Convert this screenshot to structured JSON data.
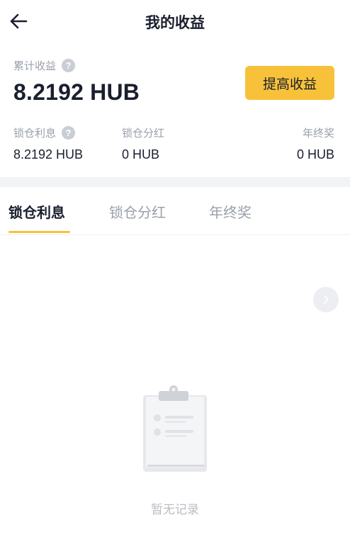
{
  "header": {
    "title": "我的收益"
  },
  "summary": {
    "total_label": "累计收益",
    "total_value": "8.2192 HUB",
    "withdraw_label": "提高收益",
    "help_glyph": "?",
    "stats": [
      {
        "label": "锁仓利息",
        "value": "8.2192 HUB"
      },
      {
        "label": "锁仓分红",
        "value": "0 HUB"
      },
      {
        "label": "年终奖",
        "value": "0 HUB"
      }
    ]
  },
  "tabs": [
    {
      "label": "锁仓利息",
      "active": true
    },
    {
      "label": "锁仓分红",
      "active": false
    },
    {
      "label": "年终奖",
      "active": false
    }
  ],
  "empty_state": {
    "text": "暂无记录",
    "icon": "clipboard-icon"
  },
  "colors": {
    "accent": "#f7c23a",
    "text_primary": "#1a1f2e",
    "text_secondary": "#9aa0ab",
    "band": "#f2f3f5"
  }
}
